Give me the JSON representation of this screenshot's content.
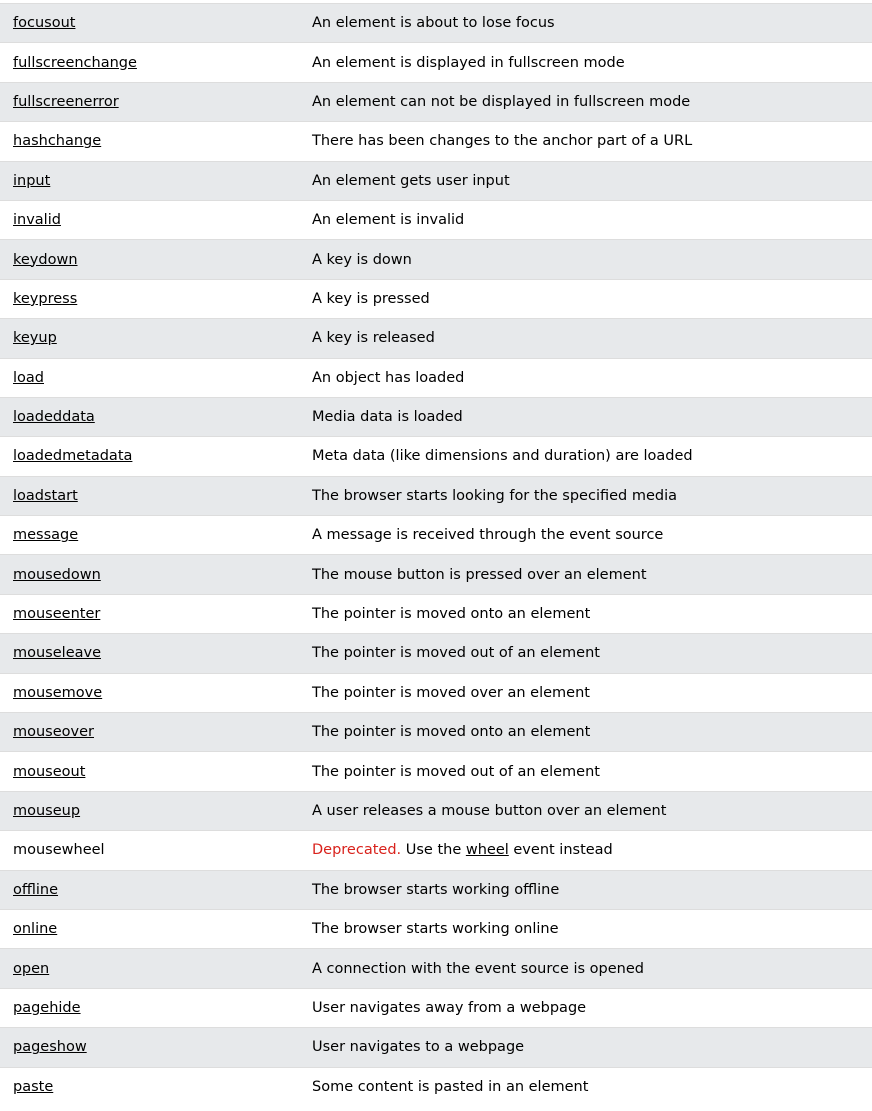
{
  "events": [
    {
      "name": "focusout",
      "link": true,
      "description": "An element is about to lose focus"
    },
    {
      "name": "fullscreenchange",
      "link": true,
      "description": "An element is displayed in fullscreen mode"
    },
    {
      "name": "fullscreenerror",
      "link": true,
      "description": "An element can not be displayed in fullscreen mode"
    },
    {
      "name": "hashchange",
      "link": true,
      "description": "There has been changes to the anchor part of a URL"
    },
    {
      "name": "input",
      "link": true,
      "description": "An element gets user input"
    },
    {
      "name": "invalid",
      "link": true,
      "description": "An element is invalid"
    },
    {
      "name": "keydown",
      "link": true,
      "description": "A key is down"
    },
    {
      "name": "keypress",
      "link": true,
      "description": "A key is pressed"
    },
    {
      "name": "keyup",
      "link": true,
      "description": "A key is released"
    },
    {
      "name": "load",
      "link": true,
      "description": "An object has loaded"
    },
    {
      "name": "loadeddata",
      "link": true,
      "description": "Media data is loaded"
    },
    {
      "name": "loadedmetadata",
      "link": true,
      "description": "Meta data (like dimensions and duration) are loaded"
    },
    {
      "name": "loadstart",
      "link": true,
      "description": "The browser starts looking for the specified media"
    },
    {
      "name": "message",
      "link": true,
      "description": "A message is received through the event source"
    },
    {
      "name": "mousedown",
      "link": true,
      "description": "The mouse button is pressed over an element"
    },
    {
      "name": "mouseenter",
      "link": true,
      "description": "The pointer is moved onto an element"
    },
    {
      "name": "mouseleave",
      "link": true,
      "description": "The pointer is moved out of an element"
    },
    {
      "name": "mousemove",
      "link": true,
      "description": "The pointer is moved over an element"
    },
    {
      "name": "mouseover",
      "link": true,
      "description": "The pointer is moved onto an element"
    },
    {
      "name": "mouseout",
      "link": true,
      "description": "The pointer is moved out of an element"
    },
    {
      "name": "mouseup",
      "link": true,
      "description": "A user releases a mouse button over an element"
    },
    {
      "name": "mousewheel",
      "link": false,
      "deprecated": "Deprecated.",
      "description_pre": " Use the ",
      "description_link": "wheel",
      "description_post": " event instead"
    },
    {
      "name": "offline",
      "link": true,
      "description": "The browser starts working offline"
    },
    {
      "name": "online",
      "link": true,
      "description": "The browser starts working online"
    },
    {
      "name": "open",
      "link": true,
      "description": "A connection with the event source is opened"
    },
    {
      "name": "pagehide",
      "link": true,
      "description": "User navigates away from a webpage"
    },
    {
      "name": "pageshow",
      "link": true,
      "description": "User navigates to a webpage"
    },
    {
      "name": "paste",
      "link": true,
      "description": "Some content is pasted in an element"
    }
  ],
  "colors": {
    "row_alt": "#e7e9eb",
    "deprecated": "#d9221c",
    "border": "#dddddd"
  }
}
